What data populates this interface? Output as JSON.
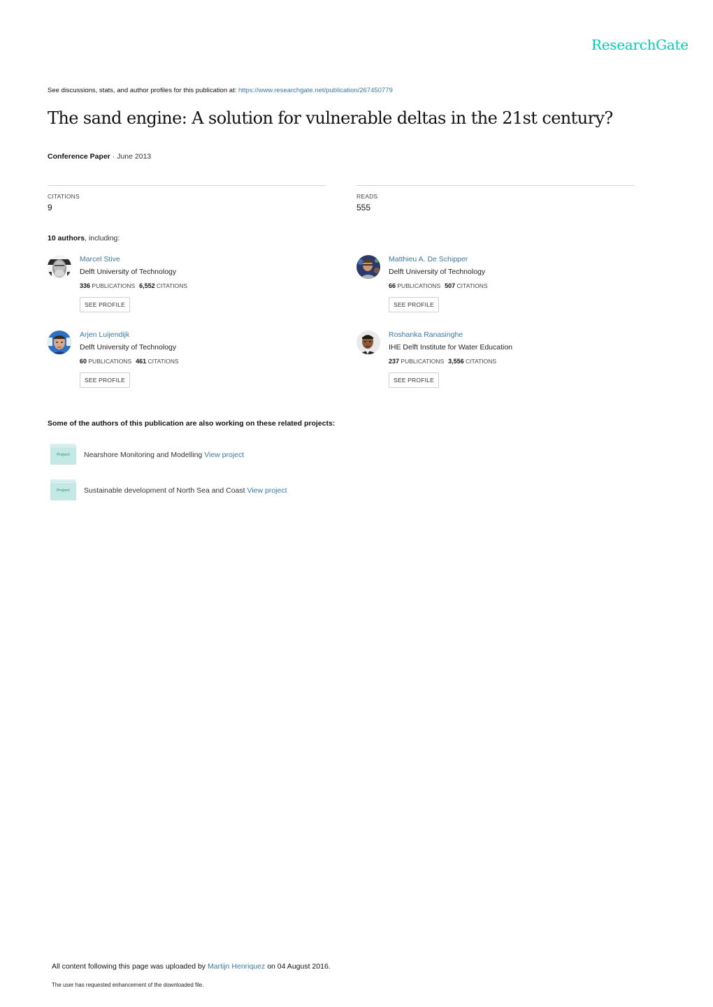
{
  "brand": {
    "name": "ResearchGate",
    "color": "#00ccbb"
  },
  "header": {
    "see_prefix": "See discussions, stats, and author profiles for this publication at: ",
    "publication_url": "https://www.researchgate.net/publication/267450779"
  },
  "publication": {
    "title": "The sand engine: A solution for vulnerable deltas in the 21st century?",
    "type": "Conference Paper",
    "separator": " · ",
    "date": "June 2013"
  },
  "stats": {
    "citations_label": "CITATIONS",
    "citations_value": "9",
    "reads_label": "READS",
    "reads_value": "555"
  },
  "authors_summary": {
    "count": "10 authors",
    "suffix": ", including:"
  },
  "authors": [
    {
      "name": "Marcel Stive",
      "institution": "Delft University of Technology",
      "publications": "336",
      "publications_label": "PUBLICATIONS",
      "citations": "6,552",
      "citations_label": "CITATIONS",
      "button": "SEE PROFILE"
    },
    {
      "name": "Matthieu A. De Schipper",
      "institution": "Delft University of Technology",
      "publications": "66",
      "publications_label": "PUBLICATIONS",
      "citations": "507",
      "citations_label": "CITATIONS",
      "button": "SEE PROFILE"
    },
    {
      "name": "Arjen Luijendijk",
      "institution": "Delft University of Technology",
      "publications": "60",
      "publications_label": "PUBLICATIONS",
      "citations": "461",
      "citations_label": "CITATIONS",
      "button": "SEE PROFILE"
    },
    {
      "name": "Roshanka Ranasinghe",
      "institution": "IHE Delft Institute for Water Education",
      "publications": "237",
      "publications_label": "PUBLICATIONS",
      "citations": "3,556",
      "citations_label": "CITATIONS",
      "button": "SEE PROFILE"
    }
  ],
  "projects": {
    "heading": "Some of the authors of this publication are also working on these related projects:",
    "icon_label": "Project",
    "items": [
      {
        "name": "Nearshore Monitoring and Modelling",
        "link": "View project"
      },
      {
        "name": "Sustainable development of North Sea and Coast",
        "link": "View project"
      }
    ]
  },
  "footer": {
    "upload_prefix": "All content following this page was uploaded by ",
    "uploader": "Martijn Henriquez",
    "upload_suffix": " on 04 August 2016.",
    "note": "The user has requested enhancement of the downloaded file."
  },
  "colors": {
    "link": "#3a78a8",
    "brand": "#00ccbb",
    "project_folder": "#c4e8e4"
  }
}
